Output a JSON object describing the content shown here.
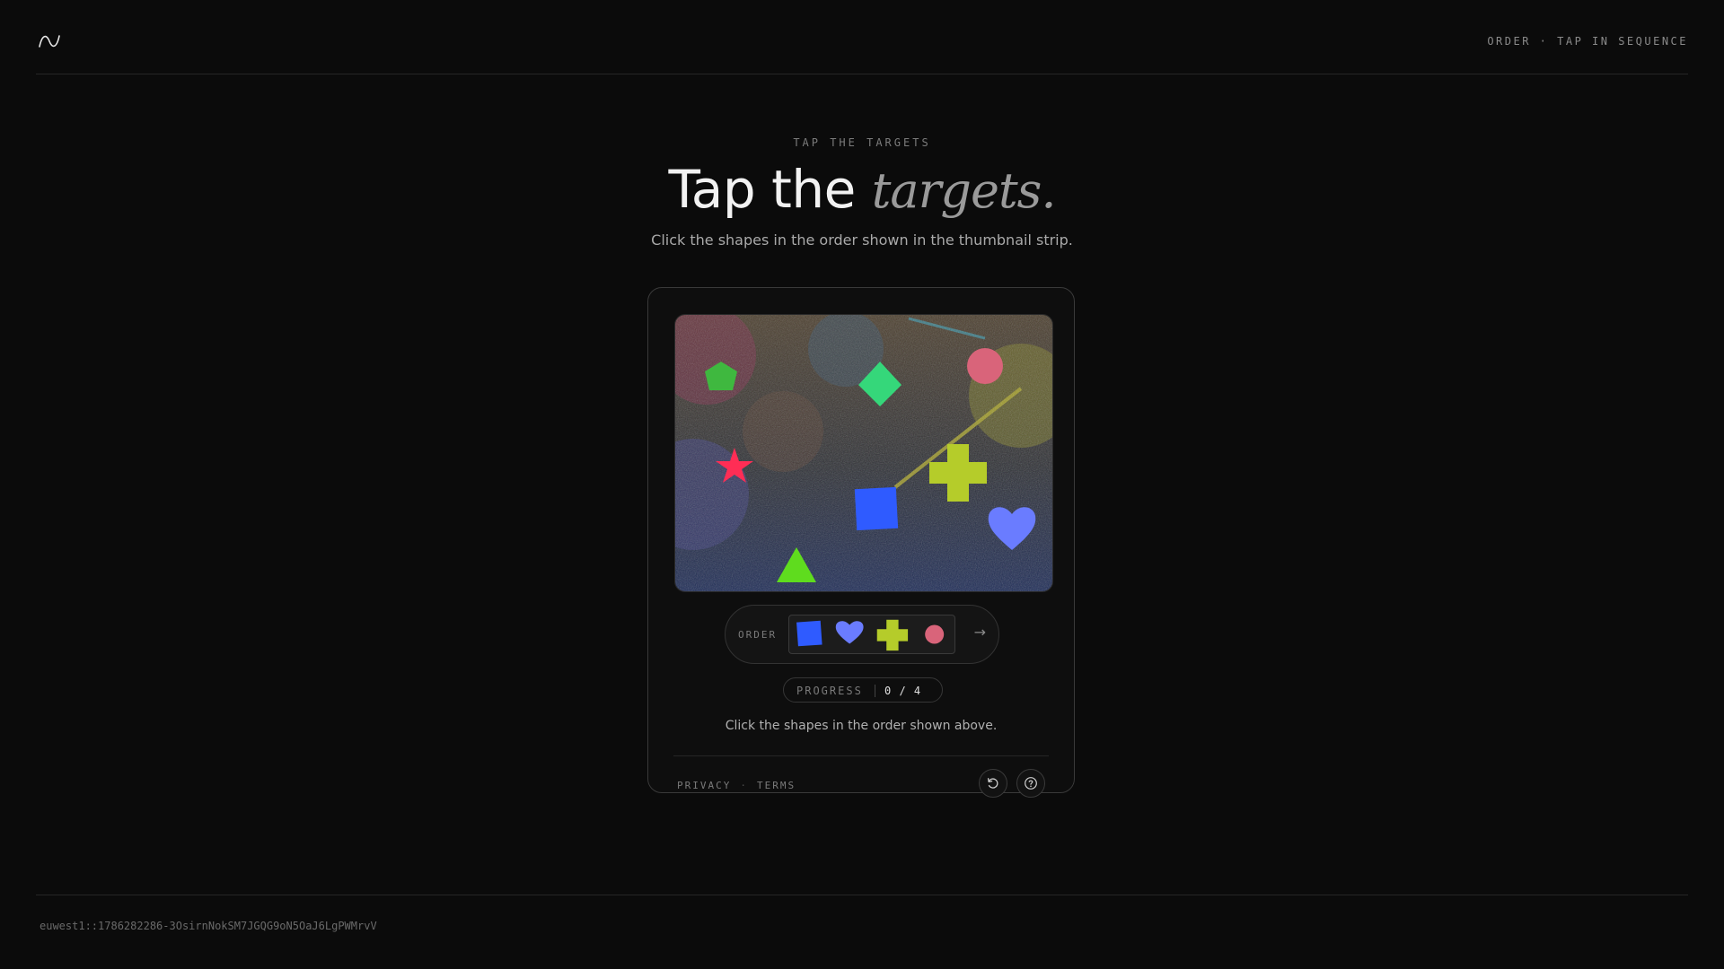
{
  "header": {
    "logo_icon": "wave-logo-icon",
    "mode_label": "ORDER · TAP IN SEQUENCE"
  },
  "hero": {
    "eyebrow": "TAP THE TARGETS",
    "title_plain": "Tap the ",
    "title_accent": "targets.",
    "subtitle": "Click the shapes in the order shown in the thumbnail strip."
  },
  "challenge": {
    "canvas_shapes": [
      "green-pentagon",
      "green-diamond",
      "pink-circle",
      "red-star",
      "yellow-green-cross",
      "blue-square",
      "blue-heart",
      "green-triangle"
    ],
    "order_label": "ORDER",
    "order_sequence": [
      "blue-square",
      "blue-heart",
      "yellow-green-cross",
      "pink-circle"
    ],
    "next_icon": "arrow-right-icon",
    "progress_label": "PROGRESS",
    "progress_value": "0 / 4",
    "progress_current": 0,
    "progress_total": 4,
    "instruction": "Click the shapes in the order shown above."
  },
  "footer": {
    "privacy": "PRIVACY",
    "separator": "·",
    "terms": "TERMS",
    "refresh_icon": "refresh-icon",
    "help_icon": "help-icon"
  },
  "session": {
    "id": "euwest1::1786282286-3OsirnNokSM7JGQG9oN5OaJ6LgPWMrvV"
  },
  "colors": {
    "background": "#0b0b0b",
    "card_border": "#3a3a3a",
    "blue_shape": "#2f5bff",
    "heart_blue": "#6a7cff",
    "cross_yellow_green": "#b5cc2a",
    "pink_circle": "#d9647a",
    "green_shape": "#3fdc7a",
    "star_red": "#ff2d55"
  }
}
